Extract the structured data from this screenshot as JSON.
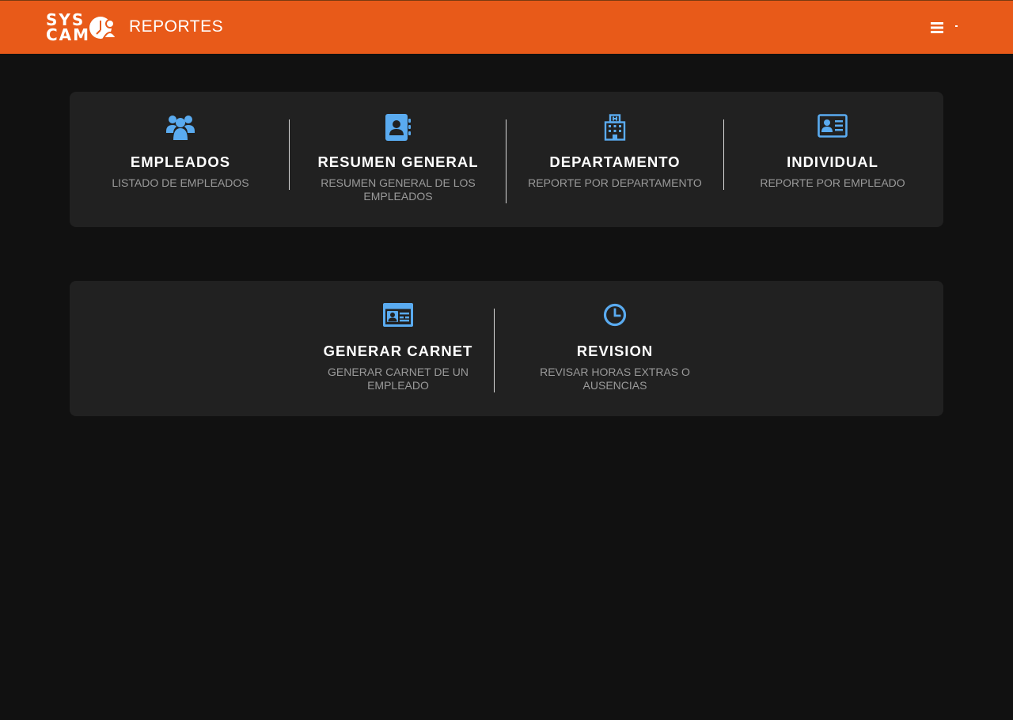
{
  "header": {
    "logo_line1": "SYS",
    "logo_line2": "CAM",
    "title": "REPORTES",
    "menu_icon": "hamburger-icon",
    "brand_color": "#e85a19"
  },
  "cards": [
    {
      "items": [
        {
          "icon": "users-group-icon",
          "title": "EMPLEADOS",
          "subtitle": "LISTADO DE EMPLEADOS"
        },
        {
          "icon": "contact-book-icon",
          "title": "RESUMEN GENERAL",
          "subtitle": "RESUMEN GENERAL DE LOS EMPLEADOS"
        },
        {
          "icon": "hospital-building-icon",
          "title": "DEPARTAMENTO",
          "subtitle": "REPORTE POR DEPARTAMENTO"
        },
        {
          "icon": "id-card-icon",
          "title": "INDIVIDUAL",
          "subtitle": "REPORTE POR EMPLEADO"
        }
      ]
    },
    {
      "items": [
        {
          "icon": "id-badge-icon",
          "title": "GENERAR CARNET",
          "subtitle": "GENERAR CARNET DE UN EMPLEADO"
        },
        {
          "icon": "clock-icon",
          "title": "REVISION",
          "subtitle": "REVISAR HORAS EXTRAS O AUSENCIAS"
        }
      ]
    }
  ],
  "accent_color": "#5aabf0"
}
